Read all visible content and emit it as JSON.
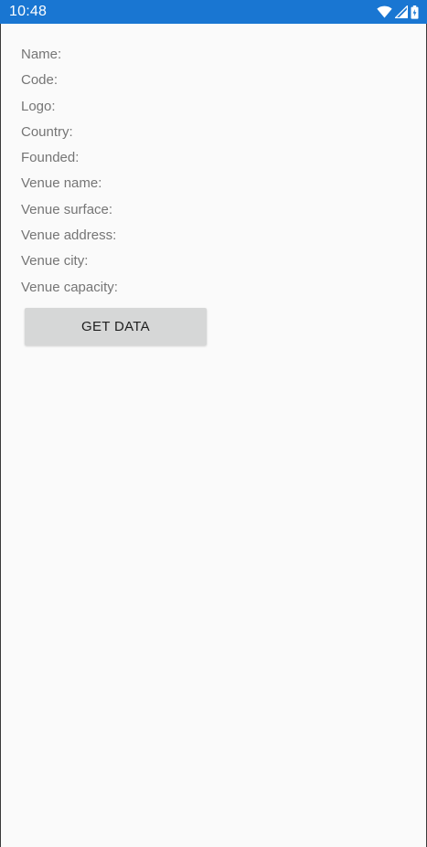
{
  "status_bar": {
    "time": "10:48",
    "icons": [
      "wifi-icon",
      "cell-signal-icon",
      "battery-icon"
    ],
    "background": "#1976d2"
  },
  "form": {
    "labels": [
      "Name:",
      "Code:",
      "Logo:",
      "Country:",
      "Founded:",
      "Venue name:",
      "Venue surface:",
      "Venue address:",
      "Venue city:",
      "Venue capacity:"
    ],
    "button_label": "GET DATA"
  }
}
